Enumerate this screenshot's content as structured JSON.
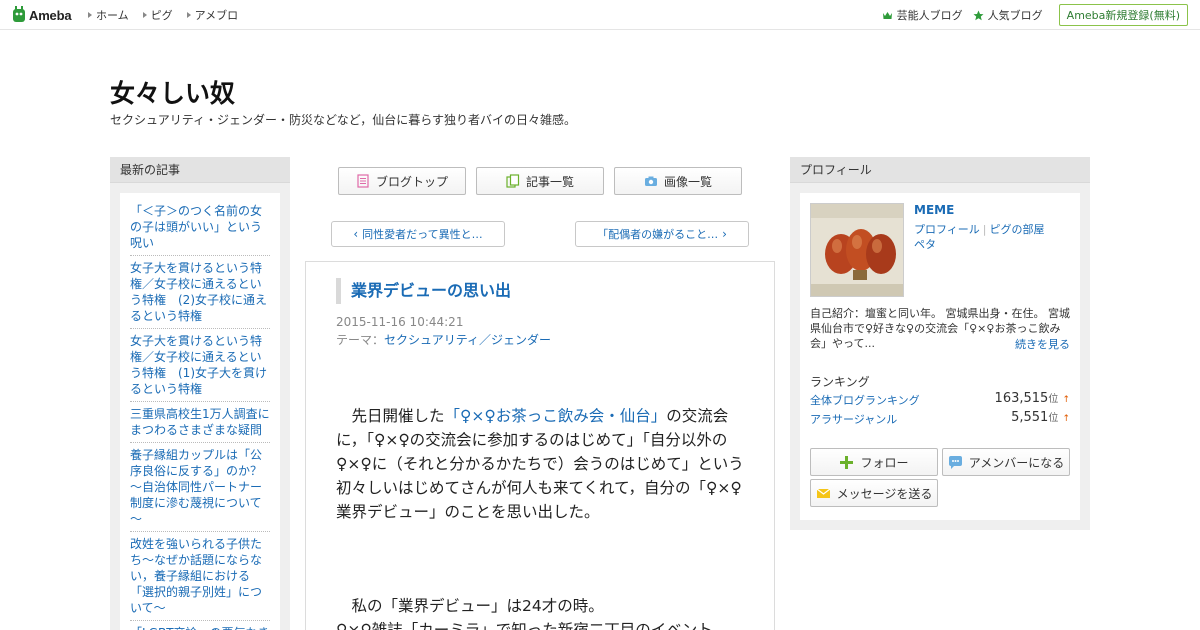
{
  "topbar": {
    "logo_text": "Ameba",
    "nav_left": [
      "ホーム",
      "ピグ",
      "アメブロ"
    ],
    "celeb_blog": "芸能人ブログ",
    "popular_blog": "人気ブログ",
    "register": "Ameba新規登録(無料)"
  },
  "header": {
    "title": "女々しい奴",
    "description": "セクシュアリティ・ジェンダー・防災などなど，仙台に暮らす独り者バイの日々雑感。"
  },
  "left": {
    "heading": "最新の記事",
    "articles": [
      "「＜子＞のつく名前の女の子は頭がいい」という呪い",
      "女子大を貫けるという特権／女子校に通えるという特権　(2)女子校に通えるという特権",
      "女子大を貫けるという特権／女子校に通えるという特権　(1)女子大を貫けるという特権",
      "三重県高校生1万人調査にまつわるさまざまな疑問",
      "養子縁組カップルは「公序良俗に反する」のか？～自治体同性パートナー制度に滲む蔑視について～",
      "改姓を強いられる子供たち～なぜか話題にならない，養子縁組における「選択的親子別姓」について～",
      "「LGBT卒論」の悪気なき"
    ]
  },
  "main": {
    "tabs": [
      "ブログトップ",
      "記事一覧",
      "画像一覧"
    ],
    "prev": "同性愛者だって異性と…",
    "next": "「配偶者の嫌がること…",
    "entry": {
      "title": "業界デビューの思い出",
      "date": "2015-11-16 10:44:21",
      "theme_label": "テーマ：",
      "theme": "セクシュアリティ／ジェンダー",
      "p1_lead": "　先日開催した",
      "p1_link": "「♀×♀お茶っこ飲み会・仙台」",
      "p1_rest": "の交流会に，「♀×♀の交流会に参加するのはじめて」「自分以外の♀×♀に（それと分かるかたちで）会うのはじめて」という初々しいはじめてさんが何人も来てくれて，自分の「♀×♀業界デビュー」のことを思い出した。",
      "p2": "　私の「業界デビュー」は24才の時。",
      "p3": "♀×♀雑誌「カーミラ」で知った新宿二丁目のイベント"
    }
  },
  "profile": {
    "heading": "プロフィール",
    "name": "MEME",
    "link_profile": "プロフィール",
    "link_room": "ピグの部屋",
    "link_peta": "ペタ",
    "intro": "自己紹介：壇蜜と同い年。 宮城県出身・在住。 宮城県仙台市で♀好きな♀の交流会「♀×♀お茶っこ飲み会」やって...",
    "read_more": "続きを見る",
    "ranking_title": "ランキング",
    "rankings": [
      {
        "label": "全体ブログランキング",
        "value": "163,515",
        "unit": "位",
        "arrow": "↑"
      },
      {
        "label": "アラサージャンル",
        "value": "5,551",
        "unit": "位",
        "arrow": "↑"
      }
    ],
    "btn_follow": "フォロー",
    "btn_member": "アメンバーになる",
    "btn_message": "メッセージを送る"
  },
  "colors": {
    "link": "#1a6bb5",
    "ameba_green": "#2e9b3a",
    "border": "#dcdcdc"
  },
  "icons": [
    "ameba-logo-icon",
    "crown-icon",
    "star-icon",
    "document-icon",
    "documents-icon",
    "camera-icon",
    "plus-icon",
    "chat-icon",
    "envelope-icon"
  ]
}
